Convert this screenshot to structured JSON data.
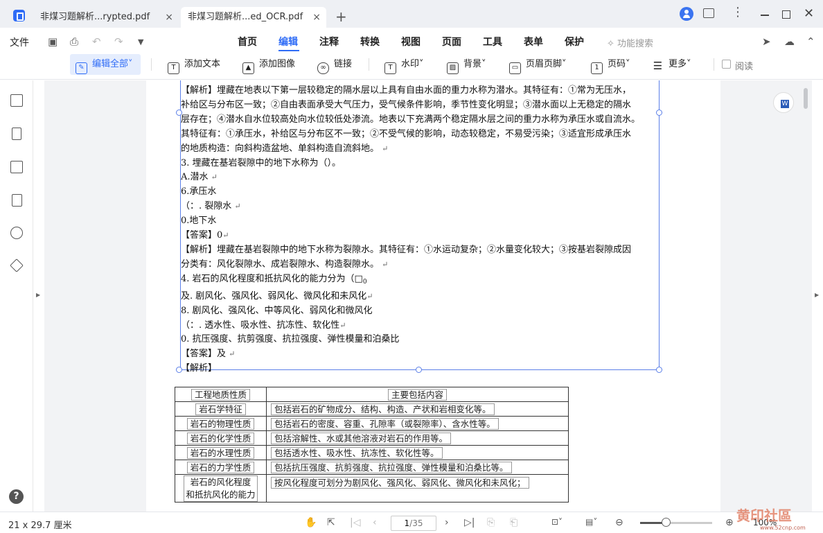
{
  "tabs": [
    {
      "title": "非煤习题解析...rypted.pdf",
      "close": "×"
    },
    {
      "title": "非煤习题解析...ed_OCR.pdf *",
      "close": "×"
    }
  ],
  "new_tab": "+",
  "window": {
    "more": "⋮",
    "close": "✕"
  },
  "menu": {
    "file": "文件",
    "items": [
      "首页",
      "编辑",
      "注释",
      "转换",
      "视图",
      "页面",
      "工具",
      "表单",
      "保护"
    ],
    "active": "编辑",
    "feature_search": "功能搜索"
  },
  "toolbar": {
    "edit_all": "编辑全部",
    "add_text": "添加文本",
    "add_image": "添加图像",
    "link": "链接",
    "watermark": "水印",
    "background": "背景",
    "header_footer": "页眉页脚",
    "page_number": "页码",
    "more": "更多",
    "read": "阅读"
  },
  "document": {
    "lines": [
      "【解析】埋藏在地表以下第一层较稳定的隔水层以上具有自由水面的重力水称为潜水。其特征有：①常为无压水，",
      "补给区与分布区一致；②自由表面承受大气压力，受气候条件影响，季节性变化明显；③潜水面以上无稳定的隔水",
      "层存在；④潜水自水位较高处向水位较低处渗流。地表以下充满两个稳定隔水层之间的重力水称为承压水或自流水。",
      "其特征有：①承压水，补给区与分布区不一致；②不受气候的影响，动态较稳定，不易受污染；③适宜形成承压水",
      "的地质构造：向斜构造盆地、单斜构造自流斜地。",
      "3. 埋藏在基岩裂隙中的地下水称为（）。",
      "A.潜水",
      "6.承压水",
      "（：. 裂隙水",
      "0.地下水",
      "【答案】0",
      "【解析】埋藏在基岩裂隙中的地下水称为裂隙水。其特征有：①水运动复杂；②水量变化较大；③按基岩裂隙成因",
      "分类有：风化裂隙水、成岩裂隙水、构造裂隙水。",
      "4. 岩石的风化程度和抵抗风化的能力分为（",
      "及. 剧风化、强风化、弱风化、微风化和未风化",
      "8. 剧风化、强风化、中等风化、弱风化和微风化",
      "（：. 透水性、吸水性、抗冻性、软化性",
      "0. 抗压强度、抗剪强度、抗拉强度、弹性模量和泊桑比",
      "【答案】及",
      "【解析】"
    ],
    "box_char": "□",
    "subscript": "0",
    "return_mark": "↵",
    "table": {
      "headers": [
        "工程地质性质",
        "主要包括内容"
      ],
      "rows": [
        [
          "岩石学特征",
          "包括岩石的矿物成分、结构、构造、产状和岩相变化等。"
        ],
        [
          "岩石的物理性质",
          "包括岩石的密度、容重、孔隙率（或裂隙率）、含水性等。"
        ],
        [
          "岩石的化学性质",
          "包括溶解性、水或其他溶液对岩石的作用等。"
        ],
        [
          "岩石的水理性质",
          "包括透水性、吸水性、抗冻性、软化性等。"
        ],
        [
          "岩石的力学性质",
          "包括抗压强度、抗剪强度、抗拉强度、弹性模量和泊桑比等。"
        ],
        [
          "岩石的风化程度\n和抵抗风化的能力",
          "按风化程度可划分为剧风化、强风化、弱风化、微风化和未风化；"
        ]
      ]
    }
  },
  "status": {
    "page_size": "21 x 29.7 厘米",
    "current_page": "1",
    "total_pages": "/35",
    "zoom": "100%",
    "zoom_level": 0.36
  },
  "watermark": {
    "text": "黄印社區",
    "url": "www.52cnp.com"
  }
}
